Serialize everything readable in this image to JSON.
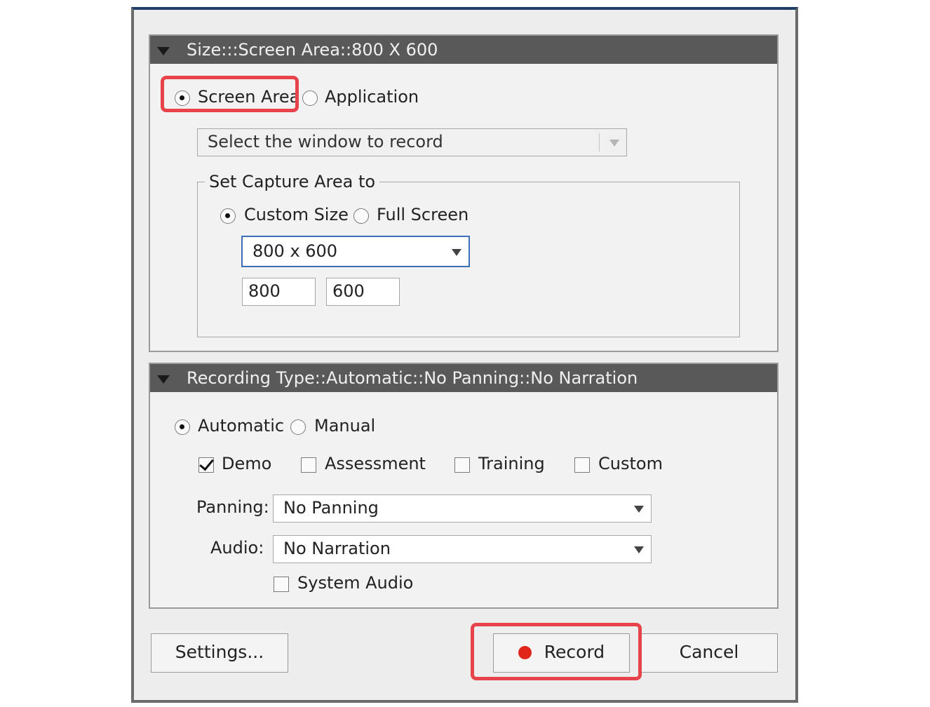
{
  "size_section": {
    "title": "Size:::Screen Area::800 X 600",
    "screen_area_label": "Screen Area",
    "application_label": "Application",
    "window_select_placeholder": "Select the window to record",
    "capture_group_label": "Set Capture Area to",
    "custom_size_label": "Custom Size",
    "full_screen_label": "Full Screen",
    "size_preset_value": "800 x 600",
    "width_value": "800",
    "height_value": "600"
  },
  "recording_section": {
    "title": "Recording Type::Automatic::No Panning::No Narration",
    "automatic_label": "Automatic",
    "manual_label": "Manual",
    "modes": [
      {
        "label": "Demo",
        "checked": true
      },
      {
        "label": "Assessment",
        "checked": false
      },
      {
        "label": "Training",
        "checked": false
      },
      {
        "label": "Custom",
        "checked": false
      }
    ],
    "panning_label": "Panning:",
    "panning_value": "No Panning",
    "audio_label": "Audio:",
    "audio_value": "No Narration",
    "system_audio_label": "System Audio"
  },
  "footer": {
    "settings_label": "Settings...",
    "record_label": "Record",
    "cancel_label": "Cancel"
  },
  "colors": {
    "highlight": "#e8434a",
    "record_dot": "#e0261b",
    "header_bg": "#595959"
  }
}
